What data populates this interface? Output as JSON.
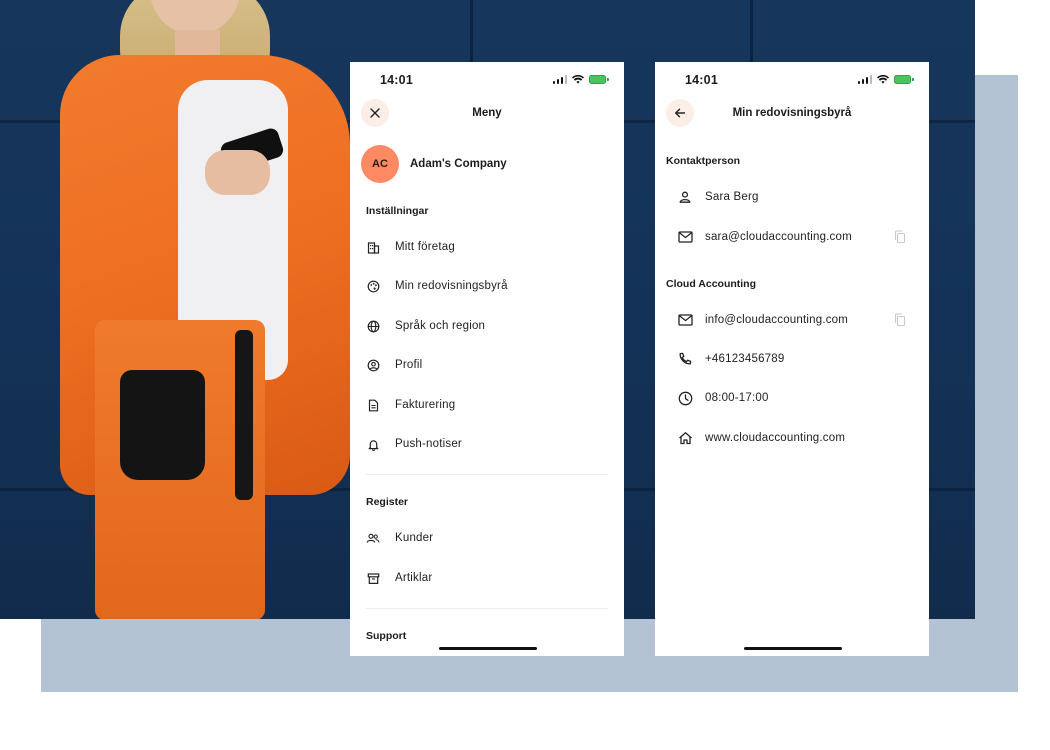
{
  "colors": {
    "accent_avatar": "#ff8962",
    "nav_button_bg": "#fbeee6",
    "backdrop_slate": "#b4c3d3",
    "photo_navy": "#143257",
    "blazer_orange": "#ef6f22",
    "battery_green": "#49c45e"
  },
  "menu_screen": {
    "status": {
      "time": "14:01"
    },
    "title": "Meny",
    "close_icon": "close-icon",
    "company": {
      "initials": "AC",
      "name": "Adam's Company"
    },
    "settings": {
      "heading": "Inställningar",
      "items": [
        {
          "label": "Mitt företag",
          "icon": "building-icon"
        },
        {
          "label": "Min redovisningsbyrå",
          "icon": "palette-icon"
        },
        {
          "label": "Språk och region",
          "icon": "globe-icon"
        },
        {
          "label": "Profil",
          "icon": "user-circle-icon"
        },
        {
          "label": "Fakturering",
          "icon": "document-icon"
        },
        {
          "label": "Push-notiser",
          "icon": "bell-icon"
        }
      ]
    },
    "register": {
      "heading": "Register",
      "items": [
        {
          "label": "Kunder",
          "icon": "users-icon"
        },
        {
          "label": "Artiklar",
          "icon": "archive-icon"
        }
      ]
    },
    "support": {
      "heading": "Support"
    }
  },
  "bureau_screen": {
    "status": {
      "time": "14:01"
    },
    "title": "Min redovisningsbyrå",
    "back_icon": "arrow-left-icon",
    "contact": {
      "heading": "Kontaktperson",
      "name": "Sara Berg",
      "email": "sara@cloudaccounting.com"
    },
    "company": {
      "heading": "Cloud Accounting",
      "email": "info@cloudaccounting.com",
      "phone": "+46123456789",
      "hours": "08:00-17:00",
      "website": "www.cloudaccounting.com"
    }
  }
}
